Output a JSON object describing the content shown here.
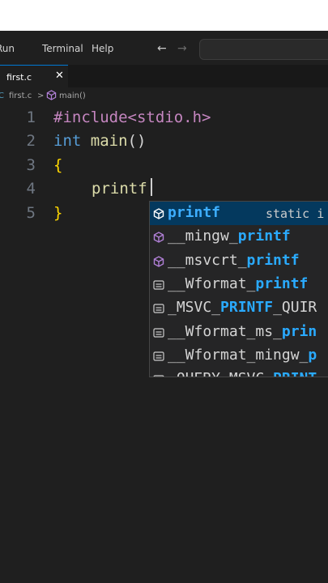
{
  "menu": {
    "items": [
      "Run",
      "Terminal",
      "Help"
    ]
  },
  "nav": {
    "back_icon": "←",
    "forward_icon": "→"
  },
  "tab": {
    "label": "first.c",
    "close_icon": "✕"
  },
  "breadcrumb": {
    "prefix": "C",
    "file": "first.c",
    "separator": ">",
    "symbol": "main()"
  },
  "editor": {
    "lines": [
      {
        "number": "1",
        "preproc": "#include",
        "header": "<stdio.h>"
      },
      {
        "number": "2",
        "type": "int",
        "name": "main",
        "parens": "()"
      },
      {
        "number": "3",
        "brace": "{"
      },
      {
        "number": "4",
        "typed": "printf"
      },
      {
        "number": "5",
        "brace": "}"
      }
    ]
  },
  "suggestions": [
    {
      "icon": "cube-icon",
      "pre": "",
      "match": "printf",
      "post": "",
      "detail": "static i",
      "selected": true
    },
    {
      "icon": "cube-icon",
      "pre": "__mingw_",
      "match": "printf",
      "post": ""
    },
    {
      "icon": "cube-icon",
      "pre": "__msvcrt_",
      "match": "printf",
      "post": ""
    },
    {
      "icon": "macro-icon",
      "pre": "__Wformat_",
      "match": "printf",
      "post": ""
    },
    {
      "icon": "macro-icon",
      "pre": "_MSVC_",
      "match": "PRINTF",
      "post": "_QUIR"
    },
    {
      "icon": "macro-icon",
      "pre": "__Wformat_ms_",
      "match": "prin",
      "post": ""
    },
    {
      "icon": "macro-icon",
      "pre": "__Wformat_mingw_",
      "match": "p",
      "post": ""
    },
    {
      "icon": "macro-icon",
      "pre": "_QUERY_MSVC_",
      "match": "PRINT",
      "post": ""
    }
  ]
}
